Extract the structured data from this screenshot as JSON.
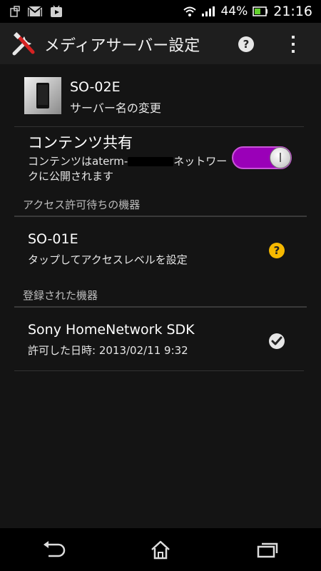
{
  "status_bar": {
    "battery_percent": "44%",
    "time": "21:16",
    "icons": [
      "sim-icon",
      "gmail-icon",
      "play-store-icon",
      "wifi-icon",
      "signal-icon",
      "battery-icon"
    ]
  },
  "action_bar": {
    "title": "メディアサーバー設定",
    "icons": [
      "settings-tools-icon",
      "help-icon",
      "overflow-menu-icon"
    ]
  },
  "server": {
    "name": "SO-02E",
    "subtitle": "サーバー名の変更"
  },
  "sharing": {
    "title": "コンテンツ共有",
    "desc_part1": "コンテンツはaterm-",
    "desc_part2": "ネットワークに公開されます",
    "enabled": true
  },
  "pending_section": {
    "header": "アクセス許可待ちの機器",
    "items": [
      {
        "name": "SO-01E",
        "subtitle": "タップしてアクセスレベルを設定",
        "status_icon": "question-badge-icon"
      }
    ]
  },
  "registered_section": {
    "header": "登録された機器",
    "items": [
      {
        "name": "Sony HomeNetwork SDK",
        "subtitle": "許可した日時: 2013/02/11  9:32",
        "status_icon": "check-badge-icon"
      }
    ]
  },
  "colors": {
    "accent_toggle": "#9a00b8",
    "pending_badge": "#f5b800",
    "background": "#141414"
  }
}
